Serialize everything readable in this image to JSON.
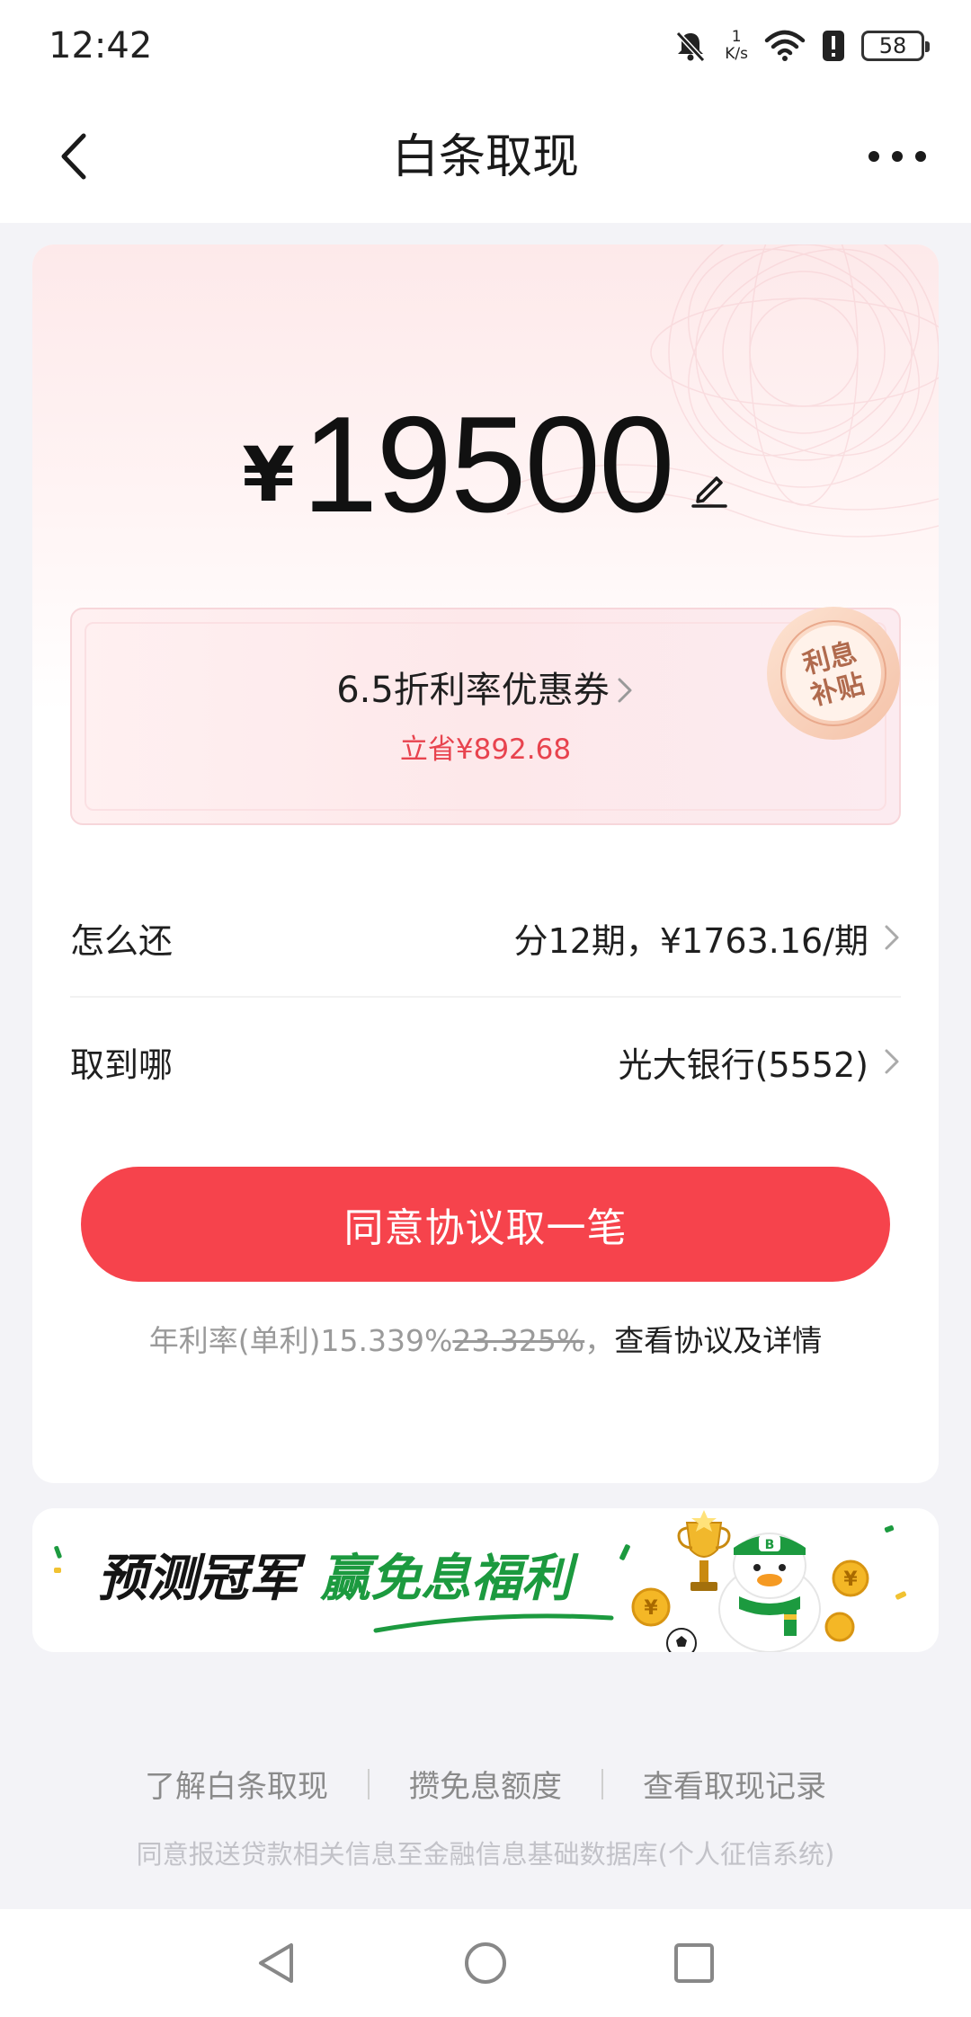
{
  "status_bar": {
    "time": "12:42",
    "net_speed_value": "1",
    "net_speed_unit": "K/s",
    "battery": "58",
    "icons": [
      "bell-mute-icon",
      "wifi-icon",
      "alert-icon",
      "battery-icon"
    ]
  },
  "nav": {
    "title": "白条取现",
    "back_icon": "chevron-left-icon",
    "more_icon": "more-dots-icon"
  },
  "amount": {
    "currency": "¥",
    "value": "19500",
    "edit_icon": "pencil-icon"
  },
  "coupon": {
    "title": "6.5折利率优惠券",
    "saving": "立省¥892.68",
    "seal_line1": "利息",
    "seal_line2": "补贴"
  },
  "repay": {
    "label": "怎么还",
    "value": "分12期，¥1763.16/期"
  },
  "destination": {
    "label": "取到哪",
    "value": "光大银行(5552)"
  },
  "primary_button": "同意协议取一笔",
  "rate": {
    "prefix": "年利率(单利)15.339%",
    "old": "23.325%",
    "separator": "，",
    "link": "查看协议及详情"
  },
  "banner": {
    "text_black": "预测冠军",
    "text_green": "赢免息福利"
  },
  "footer": {
    "links": [
      "了解白条取现",
      "攒免息额度",
      "查看取现记录"
    ],
    "notice": "同意报送贷款相关信息至金融信息基础数据库(个人征信系统)"
  },
  "colors": {
    "accent": "#f6434c",
    "saving_red": "#e8434e",
    "banner_green": "#1c9a3f",
    "page_bg": "#f3f3f7"
  }
}
